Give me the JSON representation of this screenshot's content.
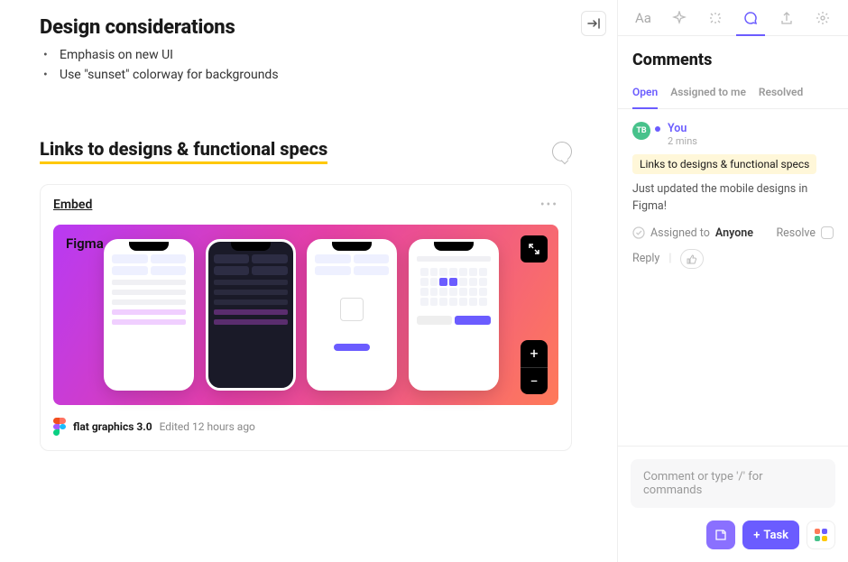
{
  "main": {
    "heading1": "Design considerations",
    "bullets": [
      "Emphasis on new UI",
      "Use \"sunset\" colorway for backgrounds"
    ],
    "heading2": "Links to designs & functional specs",
    "embed": {
      "label": "Embed",
      "figma_label": "Figma",
      "file_name": "flat graphics 3.0",
      "edited": "Edited 12 hours ago"
    }
  },
  "toolbar": {
    "items": [
      "Aa",
      "sparkle",
      "effects",
      "comment",
      "share",
      "settings"
    ],
    "active_index": 3
  },
  "comments": {
    "title": "Comments",
    "tabs": [
      "Open",
      "Assigned to me",
      "Resolved"
    ],
    "active_tab": 0,
    "thread": {
      "avatar_initials": "TB",
      "author": "You",
      "time": "2 mins",
      "context": "Links to designs & functional specs",
      "message": "Just updated the mobile designs in Figma!",
      "assigned_label": "Assigned to",
      "assigned_to": "Anyone",
      "resolve_label": "Resolve",
      "reply_label": "Reply"
    },
    "composer_placeholder": "Comment or type '/' for commands",
    "task_button": "Task"
  }
}
